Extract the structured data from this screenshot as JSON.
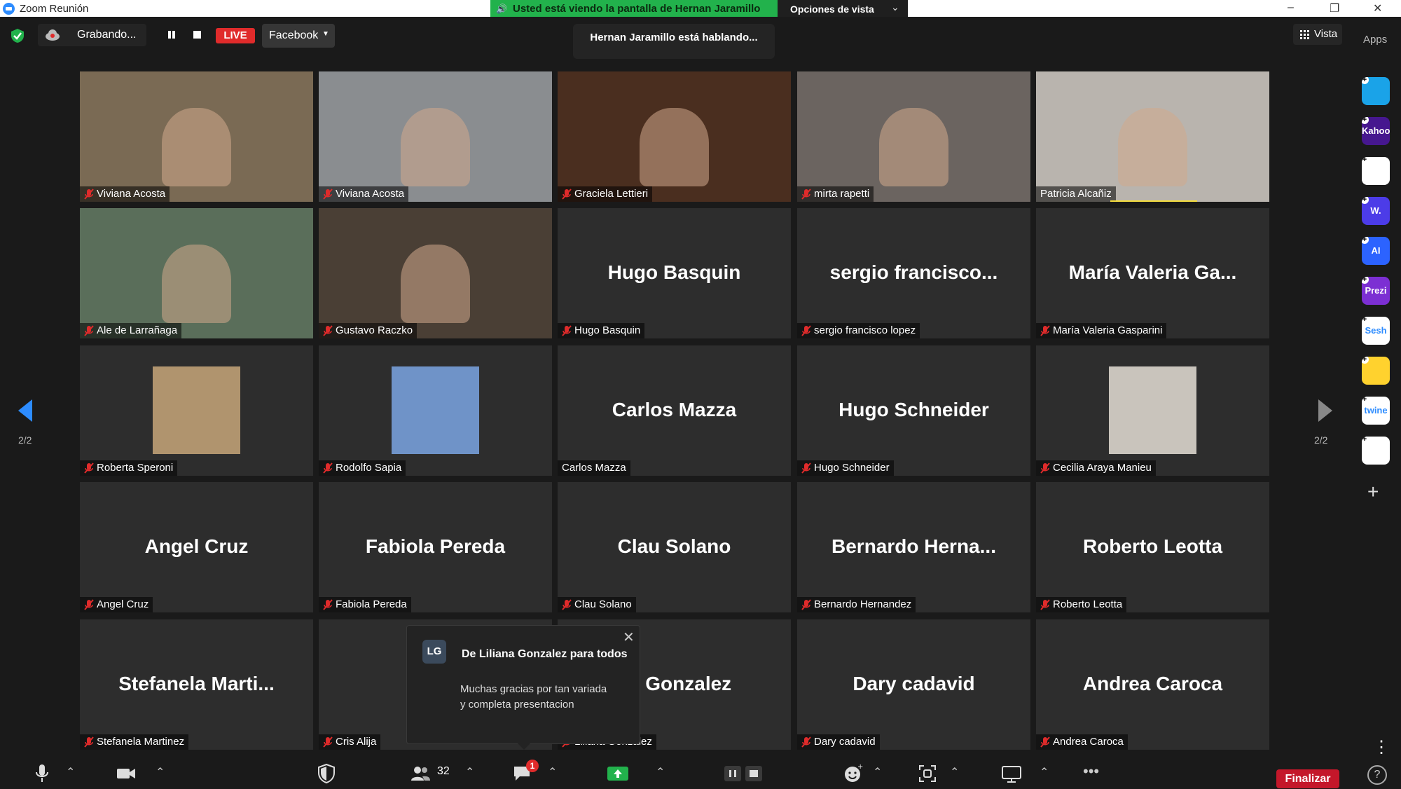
{
  "window": {
    "title": "Zoom Reunión",
    "banner": "Usted está viendo la pantalla de Hernan Jaramillo",
    "view_options": "Opciones de vista"
  },
  "toolbar": {
    "recording": "Grabando...",
    "live": "LIVE",
    "stream_target": "Facebook",
    "talking": "Hernan Jaramillo está hablando...",
    "view": "Vista",
    "apps": "Apps"
  },
  "pagination": {
    "left": "2/2",
    "right": "2/2"
  },
  "tiles": [
    {
      "big": "",
      "name": "Viviana Acosta",
      "video": true,
      "muted": true,
      "color": "#7a6a54"
    },
    {
      "big": "",
      "name": "Viviana Acosta",
      "video": true,
      "muted": true,
      "color": "#8a8d90"
    },
    {
      "big": "",
      "name": "Graciela Lettieri",
      "video": true,
      "muted": true,
      "color": "#4a2e1f"
    },
    {
      "big": "",
      "name": "mirta rapetti",
      "video": true,
      "muted": true,
      "color": "#6b6460"
    },
    {
      "big": "",
      "name": "Patricia Alcañiz",
      "video": true,
      "muted": false,
      "color": "#b9b4ae",
      "speaking": true
    },
    {
      "big": "",
      "name": "Ale de Larrañaga",
      "video": true,
      "muted": true,
      "color": "#5a6e5a"
    },
    {
      "big": "",
      "name": "Gustavo Raczko",
      "video": true,
      "muted": true,
      "color": "#4a3f35"
    },
    {
      "big": "Hugo Basquin",
      "name": "Hugo Basquin",
      "video": false,
      "muted": true
    },
    {
      "big": "sergio  francisco...",
      "name": "sergio francisco lopez",
      "video": false,
      "muted": true
    },
    {
      "big": "María Valeria Ga...",
      "name": "María Valeria Gasparini",
      "video": false,
      "muted": true
    },
    {
      "big": "",
      "name": "Roberta Speroni",
      "video": false,
      "muted": true,
      "avatar": "#b0946e"
    },
    {
      "big": "",
      "name": "Rodolfo Sapia",
      "video": false,
      "muted": true,
      "avatar": "#6f93c8"
    },
    {
      "big": "Carlos Mazza",
      "name": "Carlos Mazza",
      "video": false,
      "muted": false
    },
    {
      "big": "Hugo Schneider",
      "name": "Hugo Schneider",
      "video": false,
      "muted": true
    },
    {
      "big": "",
      "name": "Cecilia Araya Manieu",
      "video": false,
      "muted": true,
      "avatar": "#c9c4bc"
    },
    {
      "big": "Angel Cruz",
      "name": "Angel Cruz",
      "video": false,
      "muted": true
    },
    {
      "big": "Fabiola Pereda",
      "name": "Fabiola Pereda",
      "video": false,
      "muted": true
    },
    {
      "big": "Clau Solano",
      "name": "Clau Solano",
      "video": false,
      "muted": true
    },
    {
      "big": "Bernardo  Herna...",
      "name": "Bernardo Hernandez",
      "video": false,
      "muted": true
    },
    {
      "big": "Roberto Leotta",
      "name": "Roberto Leotta",
      "video": false,
      "muted": true
    },
    {
      "big": "Stefanela  Marti...",
      "name": "Stefanela Martinez",
      "video": false,
      "muted": true
    },
    {
      "big": "C",
      "name": "Cris Alija",
      "video": false,
      "muted": true
    },
    {
      "big": "na Gonzalez",
      "name": "Liliana Gonzalez",
      "video": false,
      "muted": true
    },
    {
      "big": "Dary cadavid",
      "name": "Dary cadavid",
      "video": false,
      "muted": true
    },
    {
      "big": "Andrea Caroca",
      "name": "Andrea Caroca",
      "video": false,
      "muted": true
    }
  ],
  "chat_popup": {
    "initials": "LG",
    "from": "De Liliana Gonzalez para todos",
    "line1": "Muchas gracias por tan  variada",
    "line2": "y completa presentacion"
  },
  "bottom": {
    "participants_count": "32",
    "chat_badge": "1",
    "end": "Finalizar",
    "help": "?"
  },
  "apps_rail": [
    {
      "name": "app-icon-1",
      "color": "#1aa3e8",
      "text": ""
    },
    {
      "name": "kahoot-icon",
      "color": "#46178f",
      "text": "Kahoot!"
    },
    {
      "name": "app-icon-3",
      "color": "#ffffff",
      "text": ""
    },
    {
      "name": "app-icon-w",
      "color": "#4c3ce8",
      "text": "W."
    },
    {
      "name": "app-icon-ai",
      "color": "#2c63ff",
      "text": "AI"
    },
    {
      "name": "prezi-icon",
      "color": "#7c2fd3",
      "text": "Prezi"
    },
    {
      "name": "sesh-icon",
      "color": "#ffffff",
      "text": "Sesh"
    },
    {
      "name": "app-icon-emoji",
      "color": "#ffd22e",
      "text": ""
    },
    {
      "name": "twine-icon",
      "color": "#ffffff",
      "text": "twine"
    },
    {
      "name": "app-icon-blocks",
      "color": "#ffffff",
      "text": ""
    }
  ],
  "colors": {
    "banner": "#22b24c",
    "live": "#e02b2b",
    "end": "#c4172a",
    "active_speaker": "#f4dd3c"
  }
}
